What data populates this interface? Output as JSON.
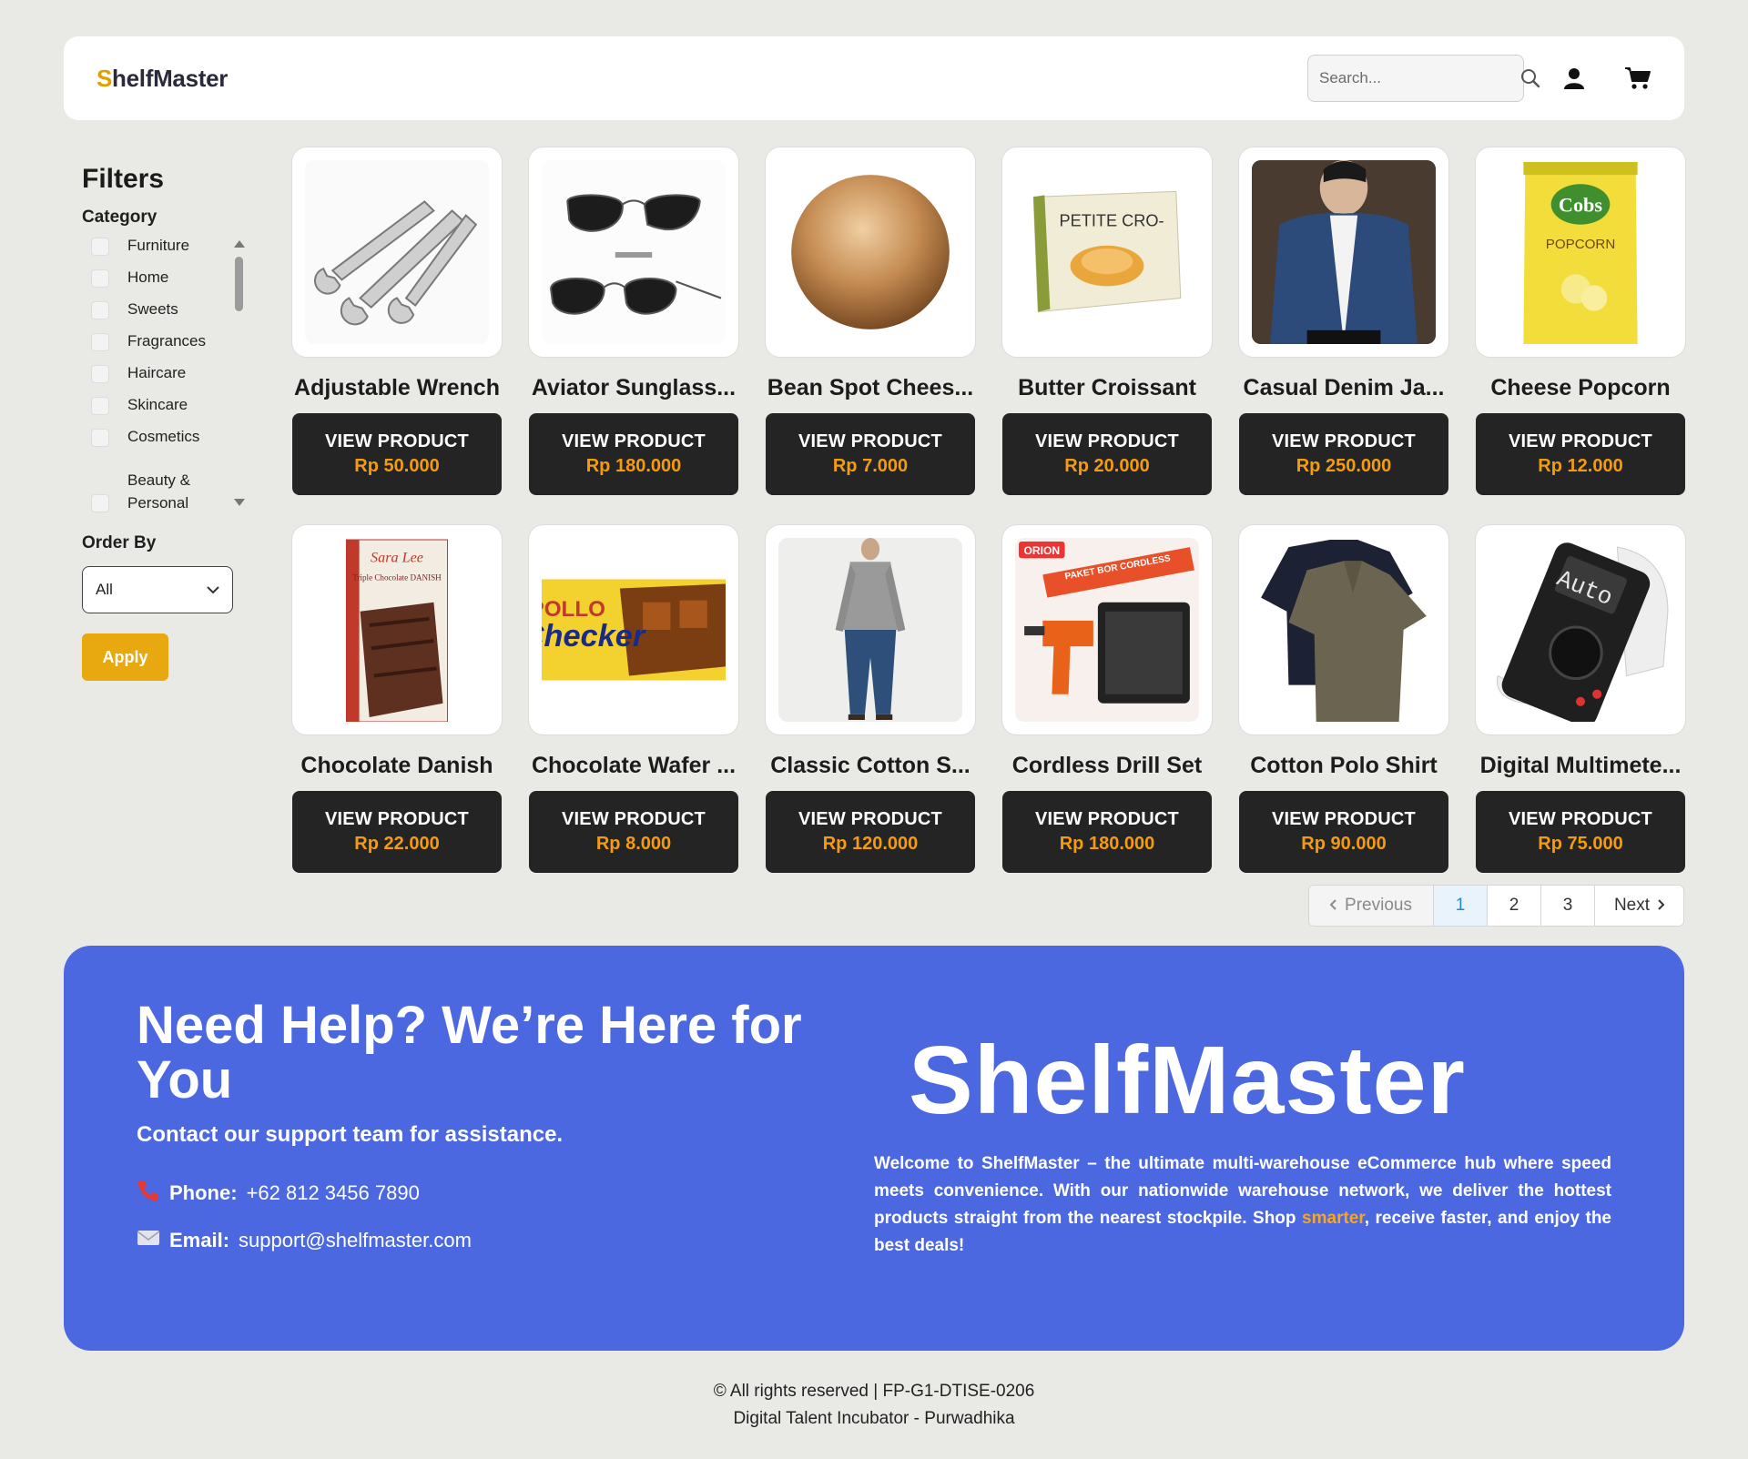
{
  "header": {
    "logo_s": "S",
    "logo_rest": "helfMaster",
    "search_placeholder": "Search..."
  },
  "sidebar": {
    "title": "Filters",
    "category_title": "Category",
    "categories": [
      "Furniture",
      "Home",
      "Sweets",
      "Fragrances",
      "Haircare",
      "Skincare",
      "Cosmetics",
      "Beauty & Personal"
    ],
    "order_title": "Order By",
    "order_value": "All",
    "apply_label": "Apply"
  },
  "view_label": "VIEW PRODUCT",
  "products": [
    {
      "name": "Adjustable Wrench",
      "price": "Rp 50.000"
    },
    {
      "name": "Aviator Sunglass...",
      "price": "Rp 180.000"
    },
    {
      "name": "Bean Spot Chees...",
      "price": "Rp 7.000"
    },
    {
      "name": "Butter Croissant",
      "price": "Rp 20.000"
    },
    {
      "name": "Casual Denim Ja...",
      "price": "Rp 250.000"
    },
    {
      "name": "Cheese Popcorn",
      "price": "Rp 12.000"
    },
    {
      "name": "Chocolate Danish",
      "price": "Rp 22.000"
    },
    {
      "name": "Chocolate Wafer ...",
      "price": "Rp 8.000"
    },
    {
      "name": "Classic Cotton S...",
      "price": "Rp 120.000"
    },
    {
      "name": "Cordless Drill Set",
      "price": "Rp 180.000"
    },
    {
      "name": "Cotton Polo Shirt",
      "price": "Rp 90.000"
    },
    {
      "name": "Digital Multimete...",
      "price": "Rp 75.000"
    }
  ],
  "product_images": {
    "croissant_box": "PETITE CRO-",
    "popcorn_brand": "Cobs",
    "popcorn_label": "POPCORN",
    "danish_brand": "Sara Lee",
    "danish_label": "Triple Chocolate DANISH",
    "wafer_brand": "POLLO",
    "wafer_label": "Checker",
    "drill_brand": "ORION",
    "drill_label": "PAKET BOR CORDLESS",
    "multimeter_label": "Auto"
  },
  "pagination": {
    "previous": "Previous",
    "pages": [
      "1",
      "2",
      "3"
    ],
    "active": "1",
    "next": "Next"
  },
  "help": {
    "title": "Need Help? We’re Here for You",
    "subtitle": "Contact our support team for assistance.",
    "phone_label": "Phone:",
    "phone_value": "+62 812 3456 7890",
    "email_label": "Email:",
    "email_value": "support@shelfmaster.com",
    "brand": "ShelfMaster",
    "desc_before": "Welcome to ShelfMaster – the ultimate multi-warehouse eCommerce hub where speed meets convenience. With our nationwide warehouse network, we deliver the hottest products straight from the nearest stockpile. Shop ",
    "desc_highlight": "smarter",
    "desc_after": ", receive faster, and enjoy the best deals!"
  },
  "footer": {
    "line1": "© All rights reserved | FP-G1-DTISE-0206",
    "line2": "Digital Talent Incubator - Purwadhika"
  },
  "colors": {
    "accent": "#e8a80f",
    "price": "#f39c12",
    "panel": "#4b68e0",
    "button": "#242424"
  }
}
